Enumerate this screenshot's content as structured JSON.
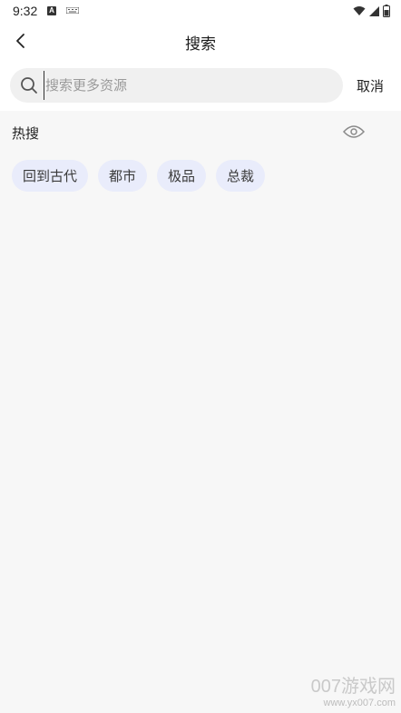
{
  "status_bar": {
    "time": "9:32",
    "app_icon_letter": "A"
  },
  "header": {
    "title": "搜索"
  },
  "search": {
    "placeholder": "搜索更多资源",
    "value": "",
    "cancel_label": "取消"
  },
  "hot": {
    "title": "热搜",
    "tags": [
      "回到古代",
      "都市",
      "极品",
      "总裁"
    ]
  },
  "watermark": {
    "logo": "007游戏网",
    "url": "www.yx007.com"
  },
  "colors": {
    "background": "#f7f7f7",
    "tag_background": "#e9ecfb",
    "placeholder": "#9a9a9a"
  }
}
